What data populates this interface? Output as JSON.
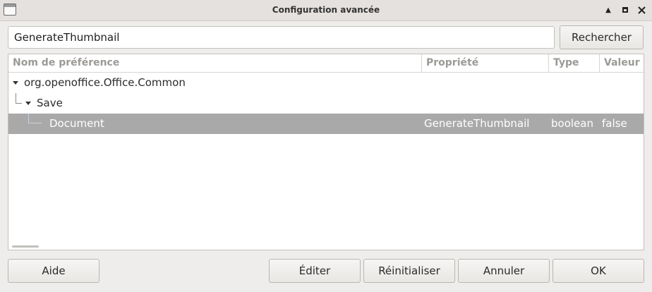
{
  "window": {
    "title": "Configuration avancée",
    "minimize_glyph": "▲"
  },
  "search": {
    "value": "GenerateThumbnail",
    "button_label": "Rechercher"
  },
  "table": {
    "columns": [
      "Nom de préférence",
      "Propriété",
      "Type",
      "Valeur"
    ],
    "rows": [
      {
        "name": "org.openoffice.Office.Common",
        "property": "",
        "type": "",
        "value": "",
        "expanded": true
      },
      {
        "name": "Save",
        "property": "",
        "type": "",
        "value": "",
        "expanded": true
      },
      {
        "name": "Document",
        "property": "GenerateThumbnail",
        "type": "boolean",
        "value": "false",
        "selected": true
      }
    ]
  },
  "buttons": {
    "help": "Aide",
    "edit": "Éditer",
    "reset": "Réinitialiser",
    "cancel": "Annuler",
    "ok": "OK"
  },
  "colors": {
    "selection": "#a9a9a9",
    "window_bg": "#efedeb"
  }
}
